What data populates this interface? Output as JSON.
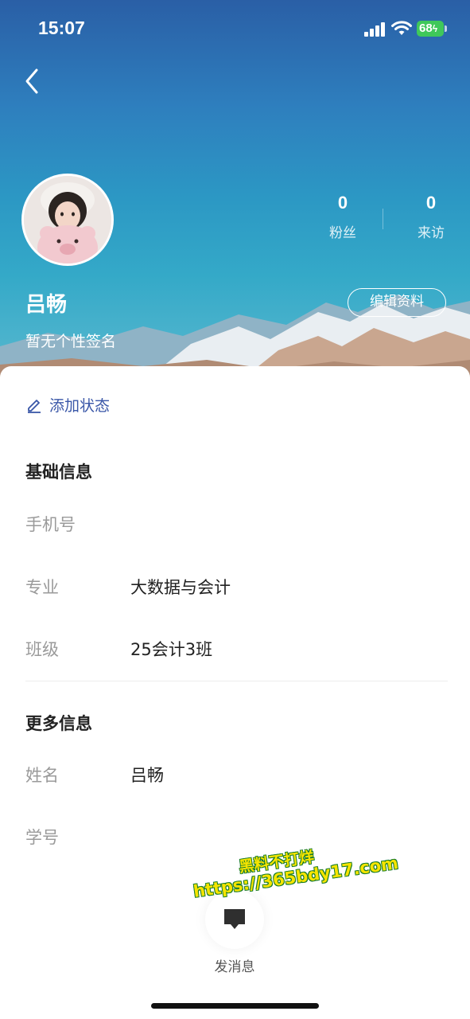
{
  "status_bar": {
    "time": "15:07",
    "battery": "68"
  },
  "profile": {
    "name": "吕畅",
    "signature": "暂无个性签名",
    "edit_label": "编辑资料",
    "stats": [
      {
        "value": "0",
        "label": "粉丝"
      },
      {
        "value": "0",
        "label": "来访"
      }
    ]
  },
  "card": {
    "add_status_label": "添加状态",
    "basic_section": {
      "title": "基础信息",
      "rows": [
        {
          "label": "手机号",
          "value": ""
        },
        {
          "label": "专业",
          "value": "大数据与会计"
        },
        {
          "label": "班级",
          "value": "25会计3班"
        }
      ]
    },
    "more_section": {
      "title": "更多信息",
      "rows": [
        {
          "label": "姓名",
          "value": "吕畅"
        },
        {
          "label": "学号",
          "value": ""
        }
      ]
    },
    "message_label": "发消息"
  },
  "watermark": {
    "line1": "黑料不打烊",
    "line2": "https://365bdy17.com"
  },
  "colors": {
    "accent_link": "#3a57a8",
    "battery_green": "#3fc85a"
  },
  "icons": [
    "back-chevron-icon",
    "pencil-icon",
    "message-icon",
    "signal-icon",
    "wifi-icon",
    "battery-icon"
  ]
}
